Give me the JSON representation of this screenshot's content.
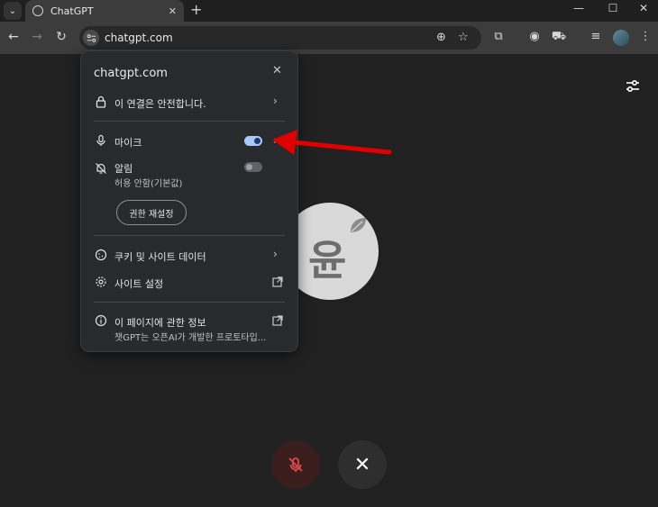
{
  "browser": {
    "tab_title": "ChatGPT",
    "tab_close": "✕",
    "new_tab": "+",
    "url": "chatgpt.com",
    "win_min": "—",
    "win_max": "☐",
    "win_close": "✕"
  },
  "popup": {
    "host": "chatgpt.com",
    "close": "✕",
    "connection_label": "이 연결은 안전합니다.",
    "mic_label": "마이크",
    "mic_enabled": true,
    "notif_label": "알림",
    "notif_sub": "허용 안함(기본값)",
    "notif_enabled": false,
    "reset_label": "권한 재설정",
    "cookies_label": "쿠키 및 사이트 데이터",
    "site_settings_label": "사이트 설정",
    "about_label": "이 페이지에 관한 정보",
    "about_sub": "챗GPT는 오픈AI가 개발한 프로토타입..."
  },
  "avatar": {
    "text": "윤"
  },
  "colors": {
    "accent": "#a8c7fa",
    "arrow": "#e00000",
    "mic_off": "#e0484a"
  }
}
